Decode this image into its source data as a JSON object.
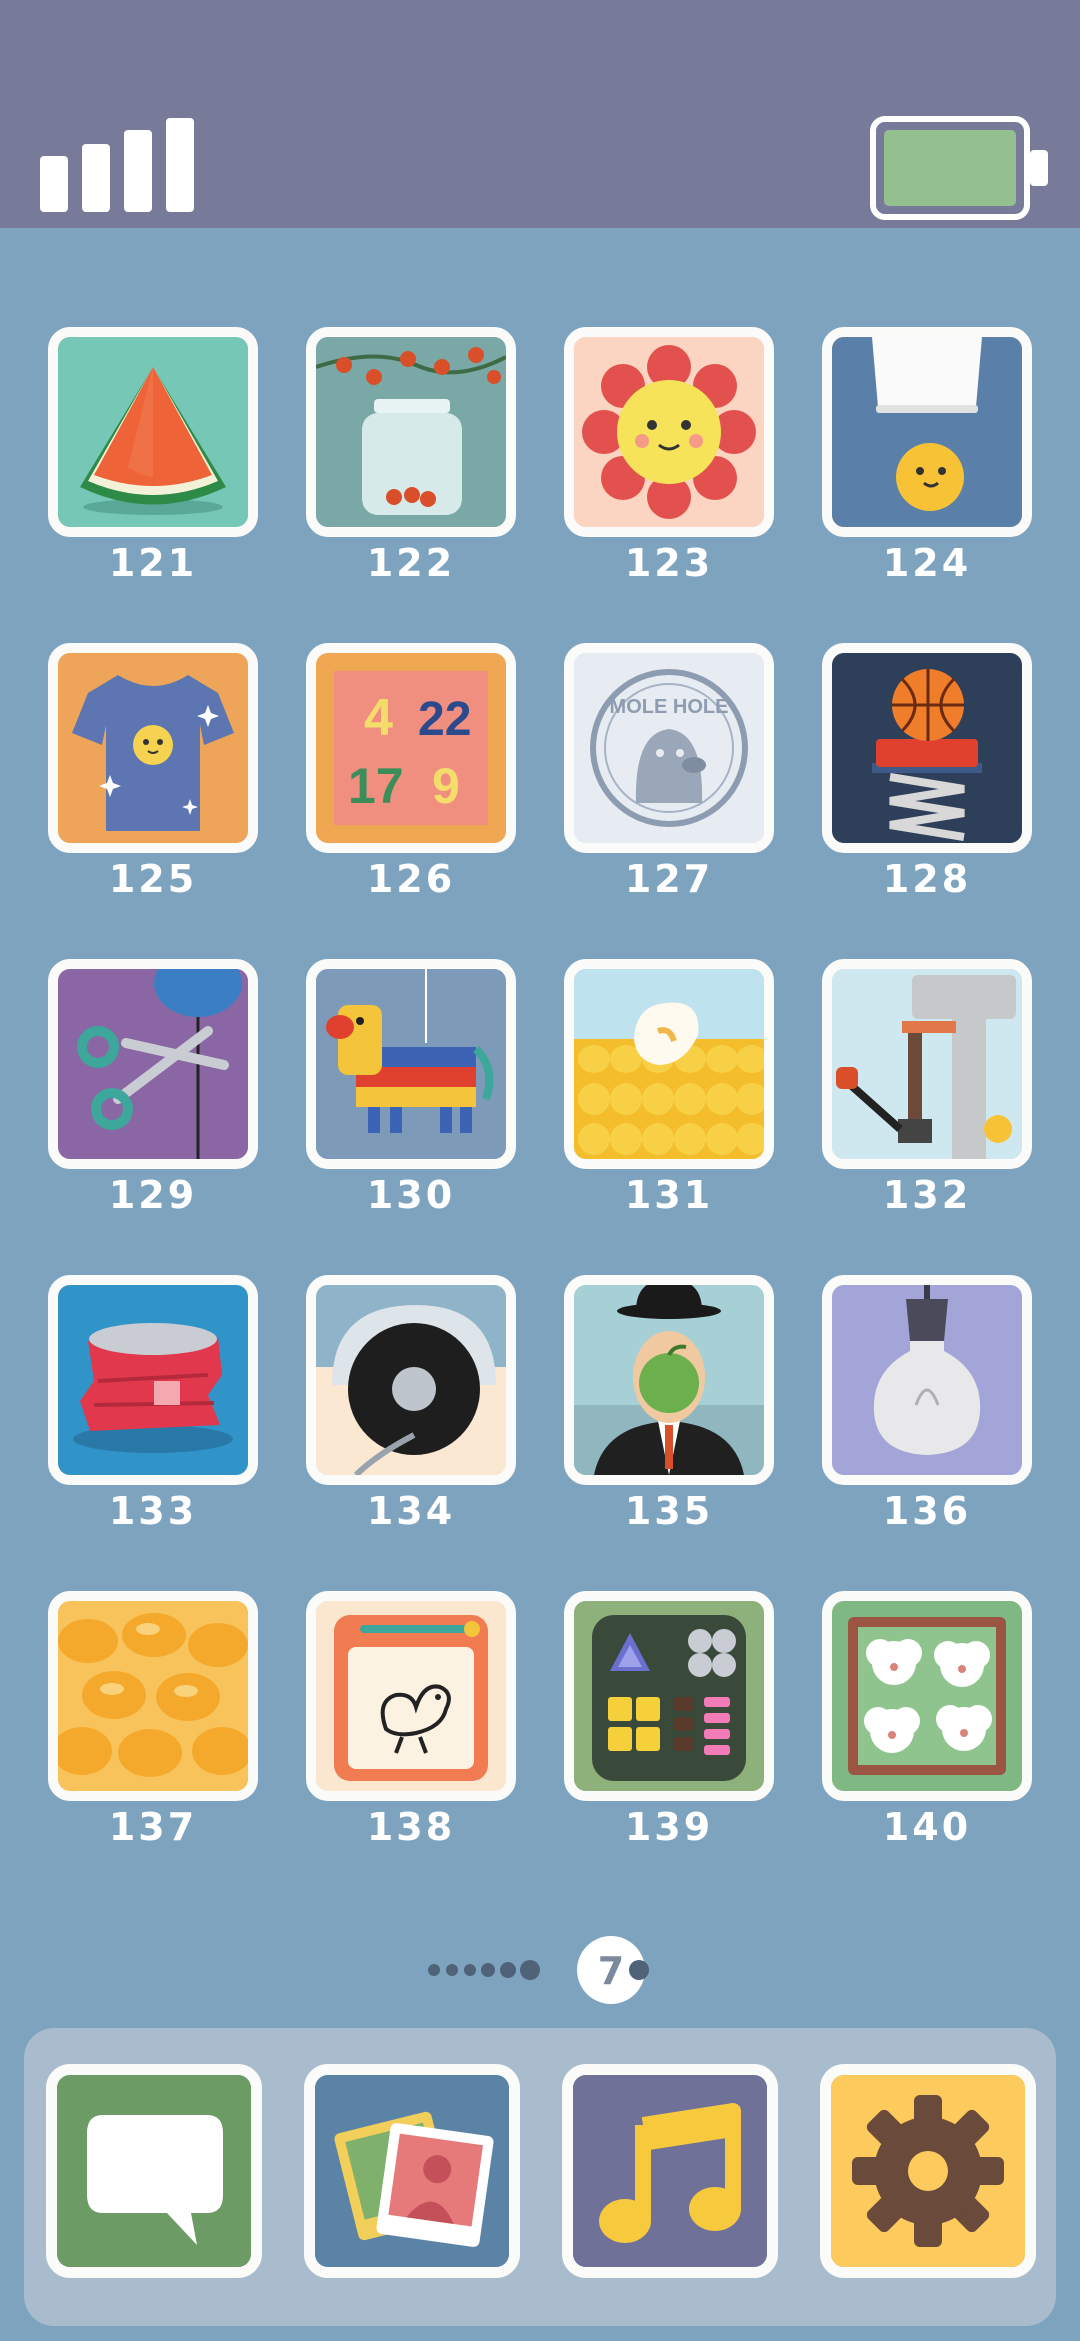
{
  "status_bar": {
    "signal_bars": 4,
    "battery_level": 1.0
  },
  "levels": [
    {
      "number": "121",
      "icon": "watermelon-icon"
    },
    {
      "number": "122",
      "icon": "berry-jar-icon"
    },
    {
      "number": "123",
      "icon": "sun-flower-icon"
    },
    {
      "number": "124",
      "icon": "chick-under-cup-icon"
    },
    {
      "number": "125",
      "icon": "tshirt-icon"
    },
    {
      "number": "126",
      "icon": "number-cards-icon"
    },
    {
      "number": "127",
      "icon": "mole-stamp-icon"
    },
    {
      "number": "128",
      "icon": "basketball-spring-icon"
    },
    {
      "number": "129",
      "icon": "scissors-balloon-icon"
    },
    {
      "number": "130",
      "icon": "pinata-icon"
    },
    {
      "number": "131",
      "icon": "popcorn-corn-icon"
    },
    {
      "number": "132",
      "icon": "stone-press-icon"
    },
    {
      "number": "133",
      "icon": "crushed-can-icon"
    },
    {
      "number": "134",
      "icon": "vacuum-icon"
    },
    {
      "number": "135",
      "icon": "apple-man-icon"
    },
    {
      "number": "136",
      "icon": "lightbulb-icon"
    },
    {
      "number": "137",
      "icon": "pasta-icon"
    },
    {
      "number": "138",
      "icon": "duck-drawing-icon"
    },
    {
      "number": "139",
      "icon": "game-board-icon"
    },
    {
      "number": "140",
      "icon": "sheep-pen-icon"
    }
  ],
  "pager": {
    "current_page": "7",
    "dot_count": 7
  },
  "dock": [
    {
      "name": "messages",
      "icon": "speech-bubble-icon",
      "color": "#6c9b65"
    },
    {
      "name": "photos",
      "icon": "photo-icon",
      "color": "#5a83a6"
    },
    {
      "name": "music",
      "icon": "music-note-icon",
      "color": "#707199"
    },
    {
      "name": "settings",
      "icon": "gear-icon",
      "color": "#fdca5e"
    }
  ]
}
